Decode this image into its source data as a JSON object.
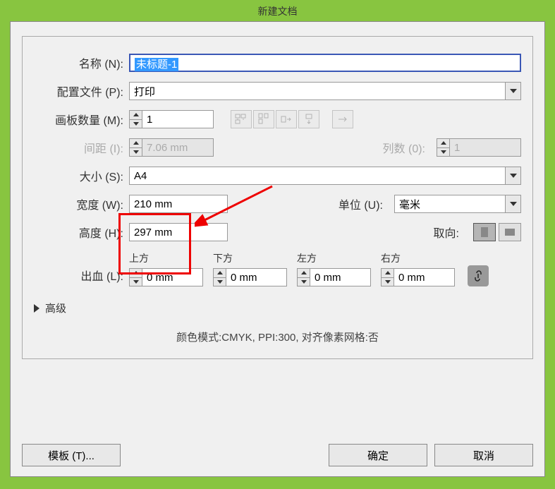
{
  "title": "新建文档",
  "labels": {
    "name": "名称 (N):",
    "profile": "配置文件 (P):",
    "artboards": "画板数量 (M):",
    "spacing": "间距 (I):",
    "columns": "列数 (0):",
    "size": "大小 (S):",
    "width": "宽度 (W):",
    "height": "高度 (H):",
    "units": "单位 (U):",
    "orientation": "取向:",
    "bleed": "出血 (L):",
    "top": "上方",
    "bottom": "下方",
    "left": "左方",
    "right": "右方",
    "advanced": "高级"
  },
  "values": {
    "name": "未标题-1",
    "profile": "打印",
    "artboards": "1",
    "spacing": "7.06 mm",
    "columns": "1",
    "size": "A4",
    "width": "210 mm",
    "height": "297 mm",
    "units": "毫米",
    "bleed_top": "0 mm",
    "bleed_bottom": "0 mm",
    "bleed_left": "0 mm",
    "bleed_right": "0 mm"
  },
  "info_line": "颜色模式:CMYK, PPI:300, 对齐像素网格:否",
  "buttons": {
    "templates": "模板 (T)...",
    "ok": "确定",
    "cancel": "取消"
  }
}
